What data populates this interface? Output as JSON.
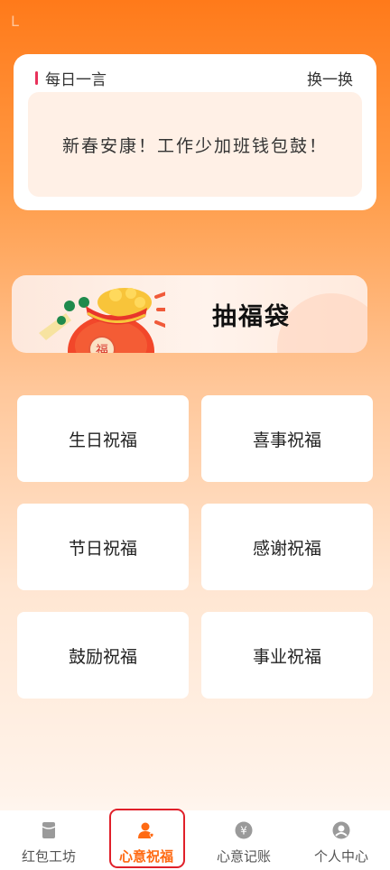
{
  "status": {
    "glyph": "L"
  },
  "quote": {
    "title": "每日一言",
    "refresh_label": "换一换",
    "text": "新春安康！工作少加班钱包鼓！"
  },
  "banner": {
    "label": "抽福袋",
    "bag_char": "福"
  },
  "blessings": [
    {
      "label": "生日祝福"
    },
    {
      "label": "喜事祝福"
    },
    {
      "label": "节日祝福"
    },
    {
      "label": "感谢祝福"
    },
    {
      "label": "鼓励祝福"
    },
    {
      "label": "事业祝福"
    }
  ],
  "tabs": [
    {
      "label": "红包工坊",
      "icon": "red-packet-icon"
    },
    {
      "label": "心意祝福",
      "icon": "user-heart-icon",
      "active": true
    },
    {
      "label": "心意记账",
      "icon": "yen-coin-icon"
    },
    {
      "label": "个人中心",
      "icon": "person-icon"
    }
  ],
  "colors": {
    "accent": "#ff6a13",
    "active_outline": "#e0202a",
    "quote_bar": "#e8315a"
  }
}
